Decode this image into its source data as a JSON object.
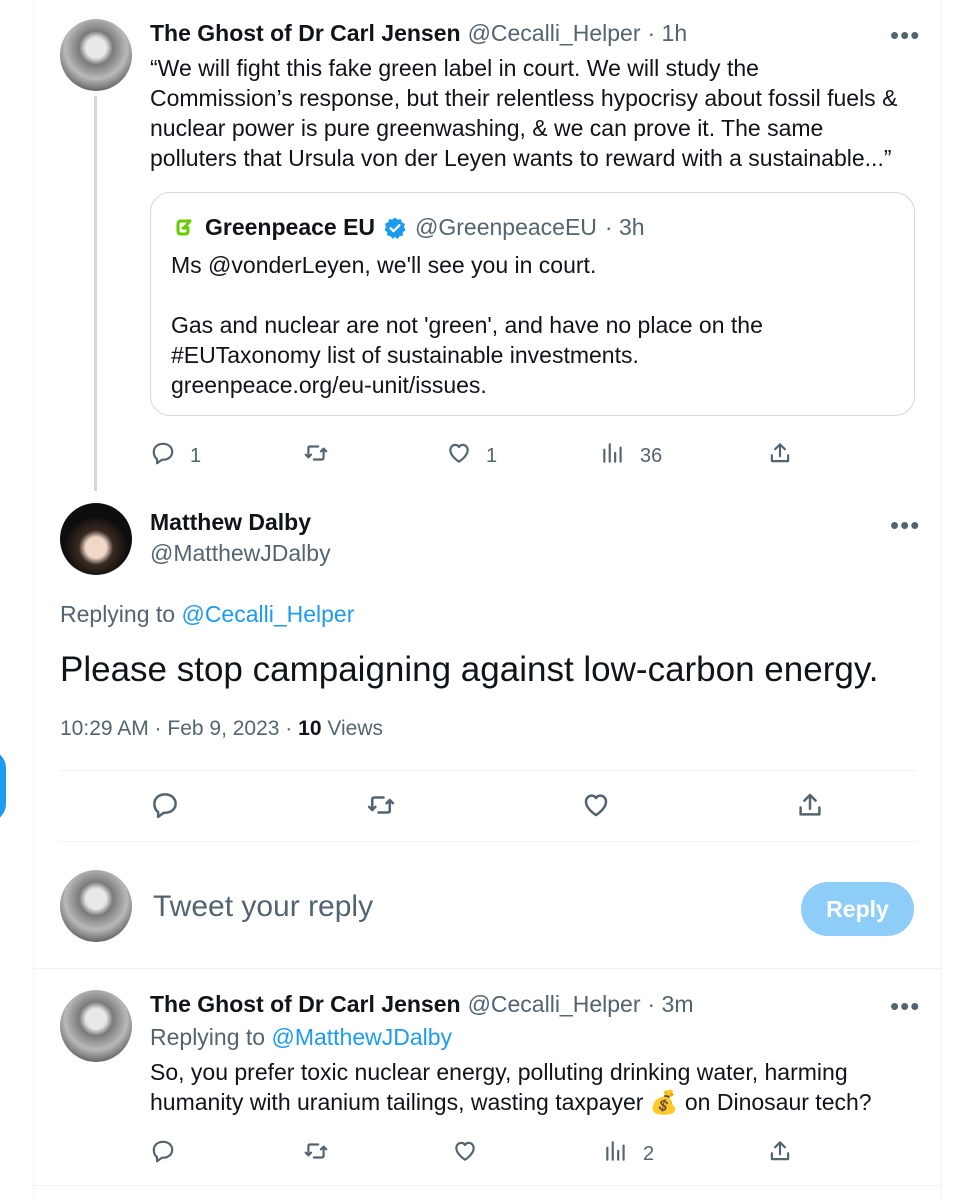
{
  "tweet1": {
    "author_name": "The Ghost of Dr Carl Jensen",
    "handle": "@Cecalli_Helper",
    "time": "· 1h",
    "text_line1": "“We will fight this fake green label in court. We will study the",
    "text_line2": "Commission’s response, but their relentless hypocrisy about fossil fuels &",
    "text_line3": "nuclear power is pure greenwashing, & we can prove it. The same",
    "text_line4": "polluters that Ursula von der Leyen wants to reward with a sustainable...”",
    "quote": {
      "name": "Greenpeace EU",
      "handle": "@GreenpeaceEU",
      "time": "· 3h",
      "line1": "Ms @vonderLeyen, we'll see you in court.",
      "line2": "Gas and nuclear are not 'green', and have no place on the",
      "line3": "#EUTaxonomy list of sustainable investments.",
      "line4": "greenpeace.org/eu-unit/issues."
    },
    "replies": "1",
    "likes": "1",
    "views": "36"
  },
  "main_tweet": {
    "author_name": "Matthew Dalby",
    "handle": "@MatthewJDalby",
    "replying_label": "Replying to",
    "replying_handle": "@Cecalli_Helper",
    "text": "Please stop campaigning against low-carbon energy.",
    "timestamp": "10:29 AM · Feb 9, 2023 ·",
    "views_count": "10",
    "views_label": "Views"
  },
  "composer": {
    "placeholder": "Tweet your reply",
    "reply_label": "Reply"
  },
  "tweet3": {
    "author_name": "The Ghost of Dr Carl Jensen",
    "handle": "@Cecalli_Helper",
    "time": "· 3m",
    "replying_label": "Replying to",
    "replying_handle": "@MatthewJDalby",
    "line1": "So, you prefer toxic nuclear energy, polluting drinking water, harming",
    "line2_a": "humanity with uranium tailings, wasting taxpayer",
    "line2_emoji": "💰",
    "line2_b": "on Dinosaur tech?",
    "views": "2"
  },
  "colors": {
    "accent": "#1d9bf0",
    "reply_button_disabled": "#8ecdf8",
    "secondary_text": "#536471",
    "greenpeace": "#66cc00"
  },
  "icons": {
    "more": "more-icon",
    "reply": "reply-icon",
    "retweet": "retweet-icon",
    "like": "heart-icon",
    "views": "views-icon",
    "share": "share-icon",
    "verified": "verified-badge-icon",
    "greenpeace": "greenpeace-logo-icon"
  }
}
